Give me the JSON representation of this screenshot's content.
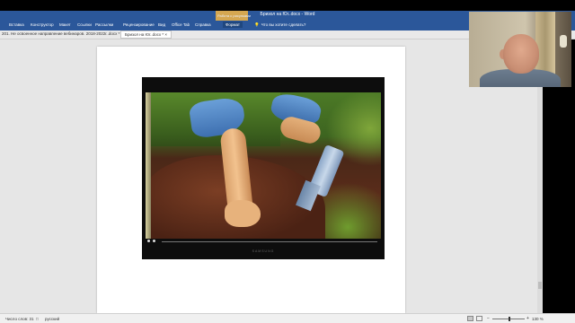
{
  "app": {
    "window_title": "Бризол на Юг..docx - Word",
    "contextual_group": "Работа с рисунками"
  },
  "ribbon": {
    "tabs": [
      {
        "label": "Вставка"
      },
      {
        "label": "Конструктор"
      },
      {
        "label": "Макет"
      },
      {
        "label": "Ссылки"
      },
      {
        "label": "Рассылки"
      },
      {
        "label": "Рецензирование"
      },
      {
        "label": "Вид"
      },
      {
        "label": "Office Tab"
      },
      {
        "label": "Справка"
      },
      {
        "label": "Формат"
      }
    ],
    "tell_me": "Что вы хотите сделать?"
  },
  "document_tabs": [
    {
      "label": "201. Не освоенное направление вебинаров. 2018-2022г..docx *",
      "active": false
    },
    {
      "label": "Бризол на Юг..docx *",
      "active": true
    }
  ],
  "status_bar": {
    "word_count": "Число слов: 31",
    "language": "русский",
    "zoom": "130 %"
  },
  "icons": {
    "tell_me": "lightbulb-icon",
    "tab_close": "close-icon",
    "zoom_out": "minus-icon",
    "zoom_in": "plus-icon"
  },
  "colors": {
    "ribbon": "#2b579a",
    "contextual_tab": "#e8b04a"
  },
  "image": {
    "brand": "SAMSUNG"
  }
}
